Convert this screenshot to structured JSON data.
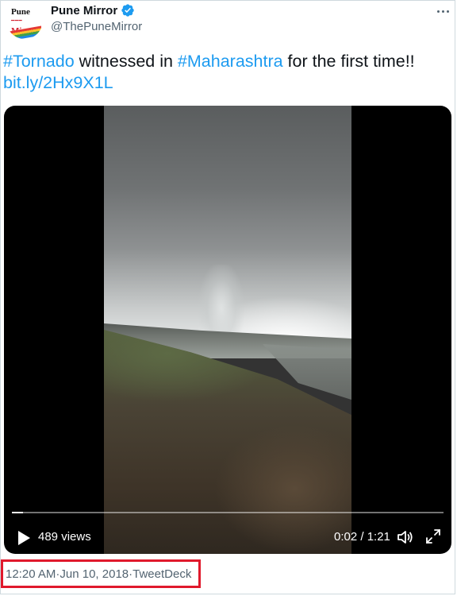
{
  "author": {
    "name": "Pune Mirror",
    "handle": "@ThePuneMirror",
    "verified": true,
    "avatar_logo_lines": [
      "Pune",
      "Mirror"
    ]
  },
  "tweet": {
    "hashtag1": "#Tornado",
    "text1": " witnessed in ",
    "hashtag2": "#Maharashtra",
    "text2": " for the first time!!",
    "link": "bit.ly/2Hx9X1L"
  },
  "video": {
    "views": "489 views",
    "time": "0:02 / 1:21",
    "progress_fraction": 0.025
  },
  "meta": {
    "time": "12:20 AM",
    "separator": " · ",
    "date": "Jun 10, 2018",
    "source": "TweetDeck"
  },
  "icons": {
    "more": "more-options-icon",
    "verified": "verified-badge-icon",
    "play": "play-icon",
    "volume": "volume-icon",
    "fullscreen": "fullscreen-icon"
  },
  "colors": {
    "link": "#1d9bf0",
    "verified": "#1d9bf0",
    "highlight_box": "#e0192c",
    "secondary_text": "#536471"
  }
}
